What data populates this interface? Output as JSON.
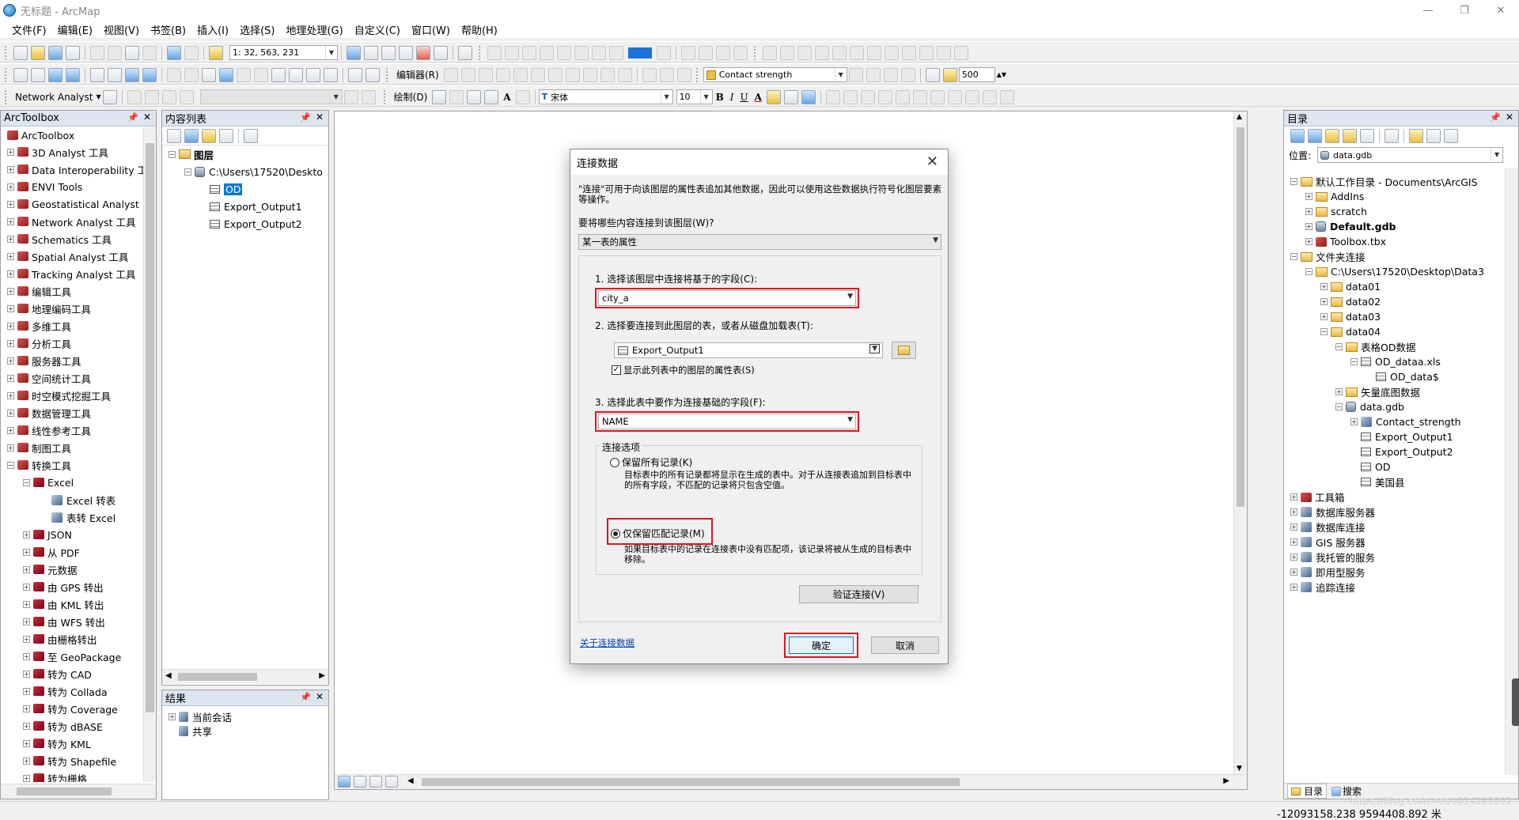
{
  "window": {
    "title": "无标题 - ArcMap",
    "min": "—",
    "max": "❐",
    "close": "✕"
  },
  "menu": [
    "文件(F)",
    "编辑(E)",
    "视图(V)",
    "书签(B)",
    "插入(I)",
    "选择(S)",
    "地理处理(G)",
    "自定义(C)",
    "窗口(W)",
    "帮助(H)"
  ],
  "toolbar": {
    "scale": "1: 32, 563, 231",
    "editor": "编辑器(R)",
    "layer_combo": "Contact strength",
    "zoom_value": "500",
    "network_analyst": "Network Analyst",
    "draw": "绘制(D)",
    "font": "宋体",
    "font_size": "10",
    "bold": "B",
    "italic": "I",
    "underline": "U",
    "text_a": "A"
  },
  "arctoolbox": {
    "title": "ArcToolbox",
    "root": "ArcToolbox",
    "items": [
      "3D Analyst 工具",
      "Data Interoperability 工",
      "ENVI Tools",
      "Geostatistical Analyst",
      "Network Analyst 工具",
      "Schematics 工具",
      "Spatial Analyst 工具",
      "Tracking Analyst 工具",
      "编辑工具",
      "地理编码工具",
      "多维工具",
      "分析工具",
      "服务器工具",
      "空间统计工具",
      "时空模式挖掘工具",
      "数据管理工具",
      "线性参考工具",
      "制图工具",
      "转换工具"
    ],
    "sub_excel": "Excel",
    "excel_tools": [
      "Excel 转表",
      "表转 Excel"
    ],
    "convert_items": [
      "JSON",
      "从 PDF",
      "元数据",
      "由 GPS 转出",
      "由 KML 转出",
      "由 WFS 转出",
      "由栅格转出",
      "至 GeoPackage",
      "转为 CAD",
      "转为 Collada",
      "转为 Coverage",
      "转为 dBASE",
      "转为 KML",
      "转为 Shapefile",
      "转为栅格"
    ]
  },
  "toc": {
    "title": "内容列表",
    "layers_label": "图层",
    "path": "C:\\Users\\17520\\Deskto",
    "tables": [
      "OD",
      "Export_Output1",
      "Export_Output2"
    ]
  },
  "results": {
    "title": "结果",
    "items": [
      "当前会话",
      "共享"
    ]
  },
  "catalog": {
    "title": "目录",
    "location_label": "位置:",
    "location_value": "data.gdb",
    "tree": [
      {
        "level": 0,
        "exp": "⊟",
        "icon": "fld",
        "label": "默认工作目录 - Documents\\ArcGIS",
        "bold": false
      },
      {
        "level": 1,
        "exp": "⊞",
        "icon": "fld",
        "label": "AddIns",
        "bold": false
      },
      {
        "level": 1,
        "exp": "⊞",
        "icon": "fld",
        "label": "scratch",
        "bold": false
      },
      {
        "level": 1,
        "exp": "⊞",
        "icon": "gdb",
        "label": "Default.gdb",
        "bold": true
      },
      {
        "level": 1,
        "exp": "⊞",
        "icon": "tbx",
        "label": "Toolbox.tbx",
        "bold": false
      },
      {
        "level": 0,
        "exp": "⊟",
        "icon": "fld",
        "label": "文件夹连接",
        "bold": false
      },
      {
        "level": 1,
        "exp": "⊟",
        "icon": "fld",
        "label": "C:\\Users\\17520\\Desktop\\Data3",
        "bold": false
      },
      {
        "level": 2,
        "exp": "⊞",
        "icon": "fld",
        "label": "data01",
        "bold": false
      },
      {
        "level": 2,
        "exp": "⊞",
        "icon": "fld",
        "label": "data02",
        "bold": false
      },
      {
        "level": 2,
        "exp": "⊞",
        "icon": "fld",
        "label": "data03",
        "bold": false
      },
      {
        "level": 2,
        "exp": "⊟",
        "icon": "fld",
        "label": "data04",
        "bold": false
      },
      {
        "level": 3,
        "exp": "⊟",
        "icon": "fld",
        "label": "表格OD数据",
        "bold": false
      },
      {
        "level": 4,
        "exp": "⊟",
        "icon": "tbl",
        "label": "OD_dataa.xls",
        "bold": false
      },
      {
        "level": 5,
        "exp": "",
        "icon": "tbl",
        "label": "OD_data$",
        "bold": false
      },
      {
        "level": 3,
        "exp": "⊞",
        "icon": "fld",
        "label": "矢量底图数据",
        "bold": false
      },
      {
        "level": 3,
        "exp": "⊟",
        "icon": "gdb",
        "label": "data.gdb",
        "bold": false
      },
      {
        "level": 4,
        "exp": "⊞",
        "icon": "tool",
        "label": "Contact_strength",
        "bold": false
      },
      {
        "level": 4,
        "exp": "",
        "icon": "tbl",
        "label": "Export_Output1",
        "bold": false
      },
      {
        "level": 4,
        "exp": "",
        "icon": "tbl",
        "label": "Export_Output2",
        "bold": false
      },
      {
        "level": 4,
        "exp": "",
        "icon": "tbl",
        "label": "OD",
        "bold": false
      },
      {
        "level": 4,
        "exp": "",
        "icon": "tbl",
        "label": "美国县",
        "bold": false
      },
      {
        "level": 0,
        "exp": "⊞",
        "icon": "tbx",
        "label": "工具箱",
        "bold": false
      },
      {
        "level": 0,
        "exp": "⊞",
        "icon": "tool",
        "label": "数据库服务器",
        "bold": false
      },
      {
        "level": 0,
        "exp": "⊞",
        "icon": "tool",
        "label": "数据库连接",
        "bold": false
      },
      {
        "level": 0,
        "exp": "⊞",
        "icon": "tool",
        "label": "GIS 服务器",
        "bold": false
      },
      {
        "level": 0,
        "exp": "⊞",
        "icon": "tool",
        "label": "我托管的服务",
        "bold": false
      },
      {
        "level": 0,
        "exp": "⊞",
        "icon": "tool",
        "label": "即用型服务",
        "bold": false
      },
      {
        "level": 0,
        "exp": "⊞",
        "icon": "tool",
        "label": "追踪连接",
        "bold": false
      }
    ],
    "tab_catalog": "目录",
    "tab_search": "搜索"
  },
  "dialog": {
    "title": "连接数据",
    "description": "\"连接\"可用于向该图层的属性表追加其他数据，因此可以使用这些数据执行符号化图层要素等操作。",
    "what_label": "要将哪些内容连接到该图层(W)?",
    "what_value": "某一表的属性",
    "step1_label": "1. 选择该图层中连接将基于的字段(C):",
    "step1_value": "city_a",
    "step2_label": "2. 选择要连接到此图层的表，或者从磁盘加载表(T):",
    "step2_value": "Export_Output1",
    "show_attr_label": "显示此列表中的图层的属性表(S)",
    "step3_label": "3. 选择此表中要作为连接基础的字段(F):",
    "step3_value": "NAME",
    "options_label": "连接选项",
    "keep_all_label": "保留所有记录(K)",
    "keep_all_desc": "目标表中的所有记录都将显示在生成的表中。对于从连接表追加到目标表中的所有字段，不匹配的记录将只包含空值。",
    "keep_match_label": "仅保留匹配记录(M)",
    "keep_match_desc": "如果目标表中的记录在连接表中没有匹配项，该记录将被从生成的目标表中移除。",
    "validate_button": "验证连接(V)",
    "about_link": "关于连接数据",
    "ok_button": "确定",
    "cancel_button": "取消"
  },
  "status": {
    "coords": "-12093158.238  9594408.892 米",
    "watermark": "https://blog.csdn.net/u014285092"
  }
}
